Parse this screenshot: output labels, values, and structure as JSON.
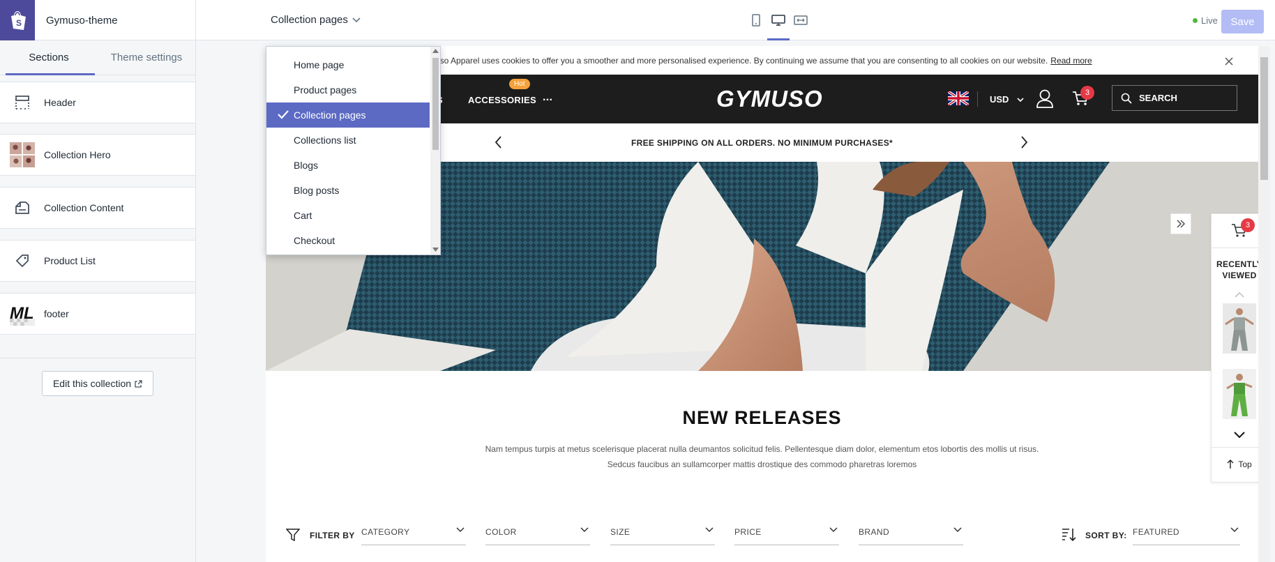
{
  "topbar": {
    "theme_name": "Gymuso-theme",
    "page_select_label": "Collection pages",
    "live_label": "Live",
    "save_label": "Save"
  },
  "sidebar": {
    "tabs": [
      {
        "label": "Sections",
        "active": true
      },
      {
        "label": "Theme settings",
        "active": false
      }
    ],
    "sections": [
      {
        "label": "Header",
        "icon": "header-layout-icon"
      },
      {
        "label": "Collection Hero",
        "icon": "collection-hero-thumbnail"
      },
      {
        "label": "Collection Content",
        "icon": "collection-content-icon"
      },
      {
        "label": "Product List",
        "icon": "tag-icon"
      },
      {
        "label": "footer",
        "icon": "footer-logo-thumbnail"
      }
    ],
    "edit_collection_label": "Edit this collection"
  },
  "dropdown": {
    "options": [
      {
        "label": "Home page",
        "selected": false
      },
      {
        "label": "Product pages",
        "selected": false
      },
      {
        "label": "Collection pages",
        "selected": true
      },
      {
        "label": "Collections list",
        "selected": false
      },
      {
        "label": "Blogs",
        "selected": false
      },
      {
        "label": "Blog posts",
        "selected": false
      },
      {
        "label": "Cart",
        "selected": false
      },
      {
        "label": "Checkout",
        "selected": false
      }
    ]
  },
  "preview": {
    "cookie_text": "uso Apparel uses cookies to offer you a smoother and more personalised experience. By continuing we assume that you are consenting to all cookies on our website.",
    "cookie_link": "Read more",
    "nav_partial": "S",
    "nav_accessories": "ACCESSORIES",
    "nav_more": "...",
    "hot_badge": "Hot",
    "brand": "GYMUSO",
    "currency": "USD",
    "cart_count": "3",
    "search_label": "SEARCH",
    "shipping_text": "FREE SHIPPING ON ALL ORDERS. NO MINIMUM PURCHASES*",
    "headline": "NEW RELEASES",
    "description_line1": "Nam tempus turpis at metus scelerisque placerat nulla deumantos solicitud felis. Pellentesque diam dolor, elementum etos lobortis des mollis ut risus.",
    "description_line2": "Sedcus faucibus an sullamcorper mattis drostique des commodo pharetras loremos",
    "filter_by_label": "FILTER BY",
    "filters": [
      "CATEGORY",
      "COLOR",
      "SIZE",
      "PRICE",
      "BRAND"
    ],
    "sort_by_label": "SORT BY:",
    "sort_value": "FEATURED",
    "recently_viewed": {
      "cart_count": "3",
      "title_line1": "RECENTLY",
      "title_line2": "VIEWED",
      "top_label": "Top"
    }
  },
  "colors": {
    "accent": "#5c6ac4",
    "shopify_logo_bg": "#4d4a9b",
    "live_dot": "#50b83c",
    "badge": "#e63946",
    "hot": "#f4a23b",
    "store_nav_bg": "#1d1d1d"
  }
}
